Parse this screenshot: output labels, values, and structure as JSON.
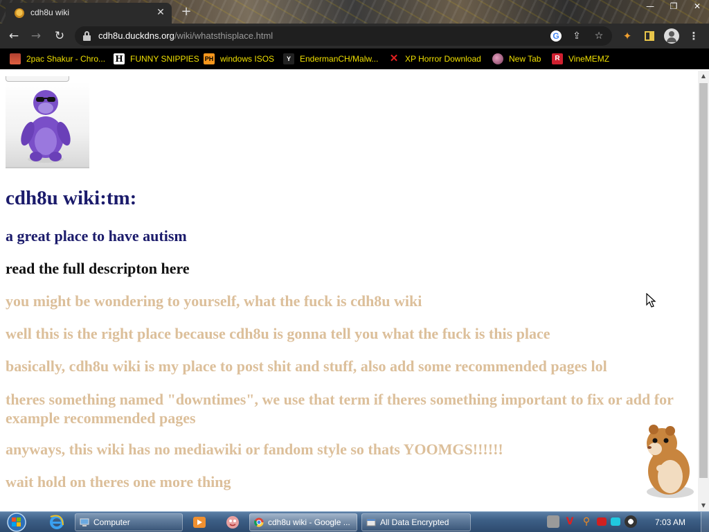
{
  "browser": {
    "tab": {
      "title": "cdh8u wiki",
      "close_glyph": "✕"
    },
    "newtab_glyph": "+",
    "window_controls": [
      "—",
      "❐",
      "✕"
    ],
    "url": {
      "domain": "cdh8u.duckdns.org",
      "path": "/wiki/whatsthisplace.html"
    },
    "nav": {
      "back": "←",
      "forward": "→",
      "reload": "↻"
    },
    "omnibox_icons": [
      "google-icon",
      "share-icon",
      "star-icon"
    ],
    "toolbar_icons": [
      "puzzle-icon",
      "sidepanel-icon",
      "profile-icon",
      "menu-icon"
    ],
    "bookmarks": [
      {
        "label": "2pac Shakur - Chro...",
        "icon": "chrome-app-icon"
      },
      {
        "label": "FUNNY SNIPPIES",
        "icon": "h-icon"
      },
      {
        "label": "windows ISOS",
        "icon": "ph-icon"
      },
      {
        "label": "EndermanCH/Malw...",
        "icon": "yp-icon"
      },
      {
        "label": "XP Horror Download",
        "icon": "red-x-icon"
      },
      {
        "label": "New Tab",
        "icon": "newtab-icon"
      },
      {
        "label": "VineMEMZ",
        "icon": "r-icon"
      }
    ],
    "bookmark_text_color": "#f0e000"
  },
  "page": {
    "title": "cdh8u wiki:tm:",
    "subtitle": "a great place to have autism",
    "read_link": "read the full descripton here",
    "paragraphs": [
      "you might be wondering to yourself, what the fuck is cdh8u wiki",
      "well this is the right place because cdh8u is gonna tell you what the fuck is this place",
      "basically, cdh8u wiki is my place to post shit and stuff, also add some recommended pages lol",
      "theres something named \"downtimes\", we use that term if theres something important to fix or add for example recommended pages",
      "anyways, this wiki has no mediawiki or fandom style so thats YOOMGS!!!!!!",
      "wait hold on theres one more thing"
    ],
    "colors": {
      "heading": "#1b1b6b",
      "body": "#dcbf9a"
    }
  },
  "taskbar": {
    "tasks": [
      {
        "label": "Computer",
        "icon": "computer-icon"
      },
      {
        "label": "cdh8u wiki - Google ...",
        "icon": "chrome-icon",
        "active": true
      },
      {
        "label": "All Data Encrypted",
        "icon": "window-icon"
      }
    ],
    "quick_launch": [
      "ie-icon",
      "media-player-icon",
      "app-icon"
    ],
    "tray_icons": [
      "network-icon",
      "antivirus-icon",
      "search-tray-icon",
      "flag-icon",
      "monitor-icon",
      "speaker-icon"
    ],
    "clock": "7:03 AM"
  }
}
